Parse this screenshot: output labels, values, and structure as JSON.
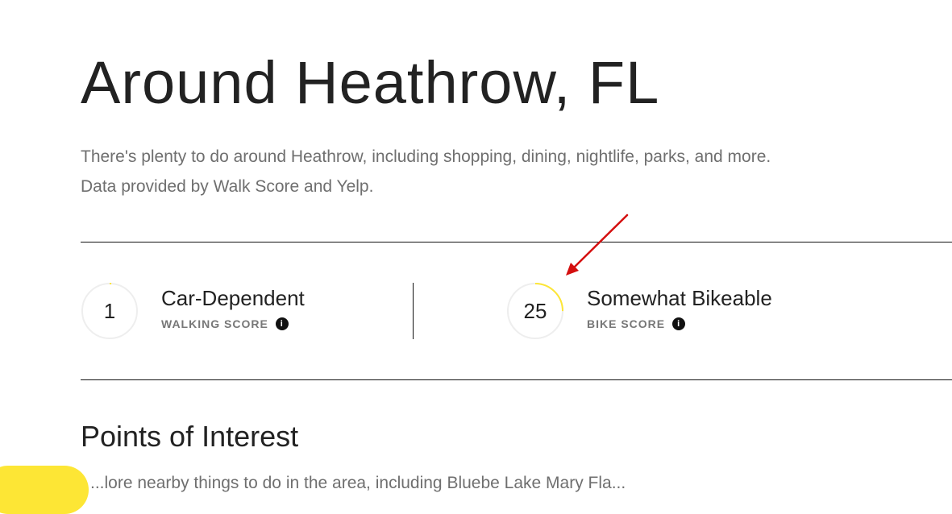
{
  "header": {
    "title": "Around Heathrow, FL",
    "intro": "There's plenty to do around Heathrow, including shopping, dining, nightlife, parks, and more. Data provided by Walk Score and Yelp."
  },
  "scores": {
    "walk": {
      "value": "1",
      "fraction": 0.01,
      "label": "Car-Dependent",
      "type": "WALKING SCORE"
    },
    "bike": {
      "value": "25",
      "fraction": 0.25,
      "label": "Somewhat Bikeable",
      "type": "BIKE SCORE"
    }
  },
  "info_icon_glyph": "i",
  "poi": {
    "title": "Points of Interest",
    "text_partial": "...lore nearby things to do in the area, including Bluebe Lake Mary Fla..."
  },
  "colors": {
    "accent_yellow": "#fde635",
    "ring_track": "#eeeeee",
    "annotation_red": "#d40f0f"
  }
}
